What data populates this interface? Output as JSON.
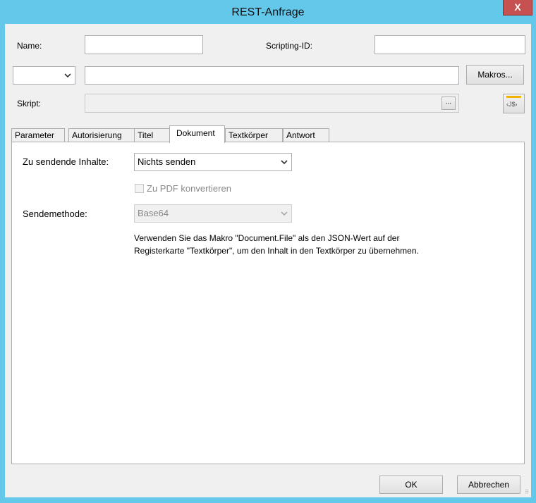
{
  "window": {
    "title": "REST-Anfrage",
    "close_glyph": "X"
  },
  "fields": {
    "name_label": "Name:",
    "name_value": "",
    "scripting_id_label": "Scripting-ID:",
    "scripting_id_value": "",
    "method_value": "",
    "url_value": "",
    "makros_button": "Makros...",
    "skript_label": "Skript:",
    "skript_value": "",
    "browse_button": "...",
    "js_button": "‹J$›"
  },
  "tabs": [
    {
      "label": "Parameter"
    },
    {
      "label": "Autorisierung"
    },
    {
      "label": "Titel"
    },
    {
      "label": "Dokument",
      "active": true
    },
    {
      "label": "Textkörper"
    },
    {
      "label": "Antwort"
    }
  ],
  "dokument": {
    "content_label": "Zu sendende Inhalte:",
    "content_value": "Nichts senden",
    "pdf_checkbox_label": "Zu PDF konvertieren",
    "pdf_checked": false,
    "method_label": "Sendemethode:",
    "method_value": "Base64",
    "info_line1": "Verwenden Sie das Makro \"Document.File\" als den JSON-Wert auf der",
    "info_line2": "Registerkarte \"Textkörper\", um den Inhalt in den Textkörper zu übernehmen."
  },
  "footer": {
    "ok_button": "OK",
    "cancel_button": "Abbrechen"
  },
  "colors": {
    "titlebar": "#64c8ea",
    "close": "#c75050",
    "dialog_bg": "#f0f0f0"
  },
  "icons": {
    "dropdown": "chevron-down-icon",
    "js": "javascript-icon",
    "resize": "resize-grip-icon"
  }
}
